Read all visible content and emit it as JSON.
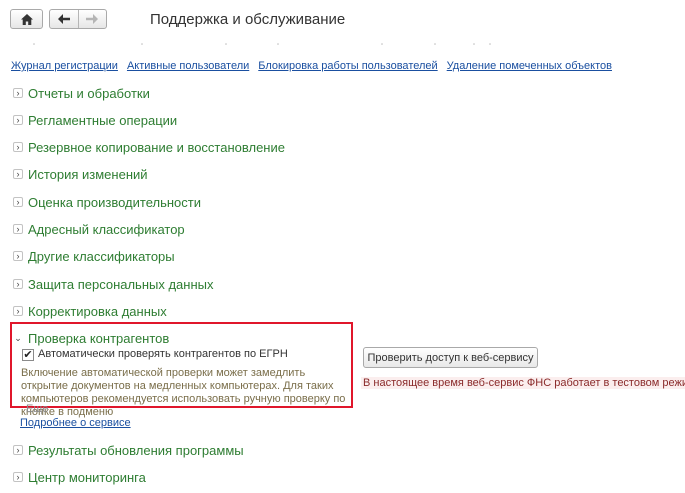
{
  "header": {
    "home_icon": "home-icon",
    "back_icon": "arrow-left-icon",
    "forward_icon": "arrow-right-icon",
    "title": "Поддержка и обслуживание"
  },
  "links": {
    "journal": "Журнал регистрации",
    "active_users": "Активные пользователи",
    "lock_users": "Блокировка работы пользователей",
    "delete_marked": "Удаление помеченных объектов"
  },
  "sections": {
    "reports": "Отчеты и обработки",
    "scheduled": "Регламентные операции",
    "backup": "Резервное копирование и восстановление",
    "history": "История изменений",
    "performance": "Оценка производительности",
    "address": "Адресный классификатор",
    "other_class": "Другие классификаторы",
    "personal": "Защита персональных данных",
    "correction": "Корректировка данных",
    "contractors": "Проверка контрагентов",
    "updates": "Результаты обновления программы",
    "monitoring": "Центр мониторинга"
  },
  "contractors": {
    "checkbox_label": "Автоматически проверять контрагентов по ЕГРН",
    "checkbox_checked": true,
    "note": "Включение автоматической проверки может замедлить открытие документов на медленных компьютерах. Для таких компьютеров рекомендуется использовать ручную проверку по кнопке в подменю",
    "more": "Еще",
    "service_link": "Подробнее о сервисе",
    "check_button": "Проверить доступ к веб-сервису",
    "warning": "В настоящее время веб-сервис ФНС работает в тестовом режиме."
  },
  "colors": {
    "section_text": "#2e7d32",
    "link": "#1a4fa0",
    "highlight_border": "#e0162b",
    "note_text": "#7a6e4a"
  }
}
